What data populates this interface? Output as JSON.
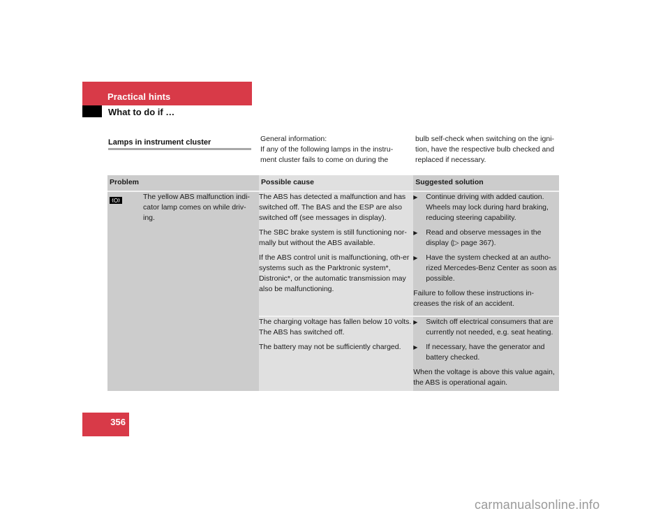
{
  "header": {
    "chapter": "Practical hints",
    "subtitle": "What to do if …"
  },
  "section": {
    "title": "Lamps in instrument cluster",
    "intro_col1": "General information:\nIf any of the following lamps in the instru-\nment cluster fails to come on during the",
    "intro_col2": "bulb self-check when switching on the igni-\ntion, have the respective bulb checked and\nreplaced if necessary."
  },
  "table": {
    "headers": [
      "Problem",
      "Possible cause",
      "Suggested solution"
    ],
    "problem": {
      "icon": "abs-warning-lamp-icon",
      "text": "The yellow ABS malfunction indi-\ncator lamp comes on while driv-\ning."
    },
    "rows": [
      {
        "causes": [
          "The ABS has detected a malfunction and has switched off. The BAS and the ESP are also switched off (see messages in display).",
          "The SBC brake system is still functioning nor-mally but without the ABS available.",
          "If the ABS control unit is malfunctioning, oth-er systems such as the Parktronic system*, Distronic*, or the automatic transmission may also be malfunctioning."
        ],
        "solutions": [
          "Continue driving with added caution. Wheels may lock during hard braking, reducing steering capability.",
          "Read and observe messages in the display (▷ page 367).",
          "Have the system checked at an autho-rized Mercedes-Benz Center as soon as possible."
        ],
        "note": "Failure to follow these instructions in-creases the risk of an accident."
      },
      {
        "causes": [
          "The charging voltage has fallen below 10 volts. The ABS has switched off.",
          "The battery may not be sufficiently charged."
        ],
        "solutions": [
          "Switch off electrical consumers that are currently not needed, e.g. seat heating.",
          "If necessary, have the generator and battery checked."
        ],
        "note": "When the voltage is above this value again, the ABS is operational again."
      }
    ],
    "bullet_glyph": "▶"
  },
  "page_number": "356",
  "watermark": "carmanualsonline.info",
  "colors": {
    "accent_red": "#d83a48",
    "header_black": "#000000"
  }
}
